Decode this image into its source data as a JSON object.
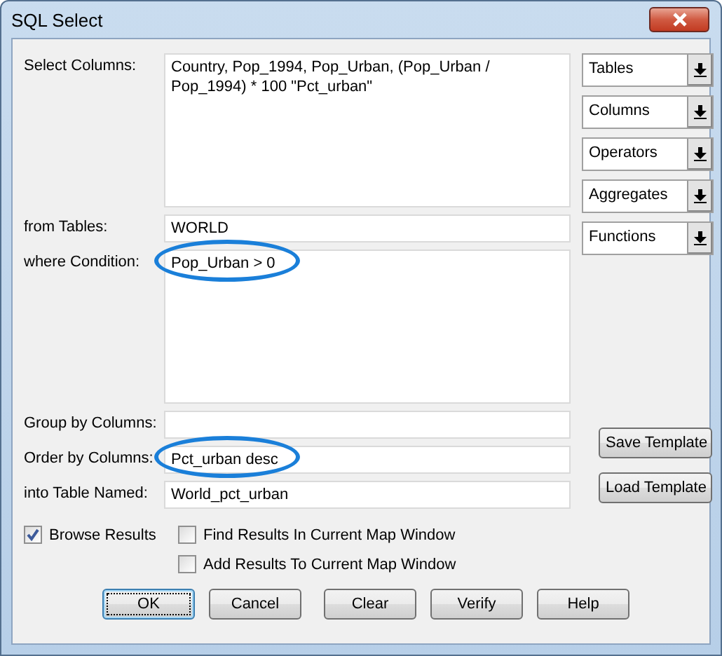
{
  "window": {
    "title": "SQL Select"
  },
  "fields": [
    {
      "label": "Select Columns:",
      "kind": "multiline",
      "value": "Country, Pop_1994, Pop_Urban, (Pop_Urban / Pop_1994) * 100 \"Pct_urban\"",
      "highlighted": false
    },
    {
      "label": "from Tables:",
      "kind": "single",
      "value": "WORLD",
      "highlighted": false
    },
    {
      "label": "where Condition:",
      "kind": "multiline",
      "value": "Pop_Urban > 0",
      "highlighted": true
    },
    {
      "label": "Group by Columns:",
      "kind": "single",
      "highlighted": false
    },
    {
      "label": "Order by Columns:",
      "kind": "single",
      "value": "Pct_urban desc",
      "highlighted": true
    },
    {
      "label": "into Table Named:",
      "kind": "single",
      "value": "World_pct_urban",
      "highlighted": false
    }
  ],
  "pickers": [
    "Tables",
    "Columns",
    "Operators",
    "Aggregates",
    "Functions"
  ],
  "template_buttons": [
    "Save Template",
    "Load Template"
  ],
  "checkboxes": [
    {
      "label": "Browse Results",
      "checked": true
    },
    {
      "label": "Find Results In Current Map Window",
      "checked": false
    },
    {
      "label": "Add Results To Current Map Window",
      "checked": false
    }
  ],
  "buttons": [
    {
      "label": "OK",
      "default": true
    },
    {
      "label": "Cancel",
      "default": false
    },
    {
      "label": "Clear",
      "default": false
    },
    {
      "label": "Verify",
      "default": false
    },
    {
      "label": "Help",
      "default": false
    }
  ]
}
